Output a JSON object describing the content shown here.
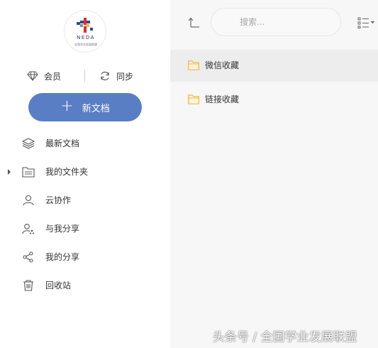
{
  "logo": {
    "text": "NEDA",
    "subtitle": "全国学业发展联盟"
  },
  "account": {
    "member_label": "会员",
    "sync_label": "同步"
  },
  "new_doc_label": "新文档",
  "nav": {
    "items": [
      {
        "label": "最新文档",
        "icon": "layers-icon"
      },
      {
        "label": "我的文件夹",
        "icon": "folder-outline-icon",
        "expandable": true
      },
      {
        "label": "云协作",
        "icon": "user-icon"
      },
      {
        "label": "与我分享",
        "icon": "shared-with-me-icon"
      },
      {
        "label": "我的分享",
        "icon": "share-icon"
      },
      {
        "label": "回收站",
        "icon": "trash-icon"
      }
    ]
  },
  "toolbar": {
    "search_placeholder": "搜索...",
    "up_icon": "up-level-icon",
    "view_icon": "list-view-icon"
  },
  "folders": [
    {
      "name": "微信收藏",
      "selected": true
    },
    {
      "name": "链接收藏",
      "selected": false
    }
  ],
  "watermark": "头条号 / 全国学业发展联盟",
  "colors": {
    "accent": "#5a7ec3",
    "folder": "#f0b550",
    "sidebar_bg": "#ffffff",
    "main_bg": "#f7f7f7",
    "selected_row": "#ededed"
  }
}
